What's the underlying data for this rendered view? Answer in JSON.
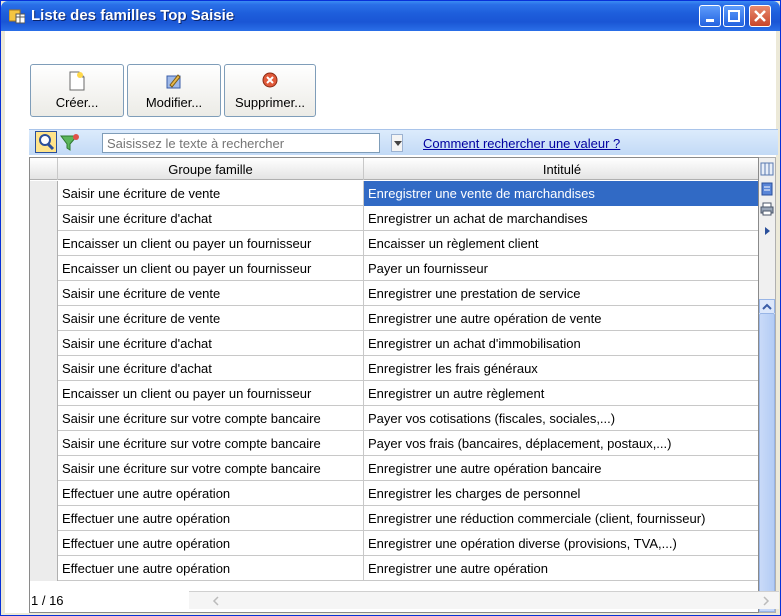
{
  "window": {
    "title": "Liste des familles Top Saisie",
    "icon": "folder-grid-icon"
  },
  "toolbar": {
    "create_label": "Créer...",
    "modify_label": "Modifier...",
    "delete_label": "Supprimer..."
  },
  "search": {
    "placeholder": "Saisissez le texte à rechercher",
    "help_link": "Comment rechercher une valeur ?"
  },
  "table": {
    "columns": [
      "Groupe famille",
      "Intitulé"
    ],
    "rows": [
      [
        "Saisir une écriture de vente",
        "Enregistrer une vente de marchandises"
      ],
      [
        "Saisir une écriture d'achat",
        "Enregistrer un achat de marchandises"
      ],
      [
        "Encaisser un client ou payer un fournisseur",
        "Encaisser un règlement client"
      ],
      [
        "Encaisser un client ou payer un fournisseur",
        "Payer un fournisseur"
      ],
      [
        "Saisir une écriture de vente",
        "Enregistrer une prestation de service"
      ],
      [
        "Saisir une écriture de vente",
        "Enregistrer une autre opération de vente"
      ],
      [
        "Saisir une écriture d'achat",
        "Enregistrer un achat d'immobilisation"
      ],
      [
        "Saisir une écriture d'achat",
        "Enregistrer les frais généraux"
      ],
      [
        "Encaisser un client ou payer un fournisseur",
        "Enregistrer un autre règlement"
      ],
      [
        "Saisir une écriture sur votre compte bancaire",
        "Payer vos cotisations (fiscales, sociales,...)"
      ],
      [
        "Saisir une écriture sur votre compte bancaire",
        "Payer vos frais (bancaires, déplacement, postaux,...)"
      ],
      [
        "Saisir une écriture sur votre compte bancaire",
        "Enregistrer une autre opération bancaire"
      ],
      [
        "Effectuer une autre opération",
        "Enregistrer les charges de personnel"
      ],
      [
        "Effectuer une autre opération",
        "Enregistrer une réduction commerciale (client, fournisseur)"
      ],
      [
        "Effectuer une autre opération",
        "Enregistrer une opération diverse (provisions, TVA,...)"
      ],
      [
        "Effectuer une autre opération",
        "Enregistrer une autre opération"
      ]
    ],
    "selected_row": 0
  },
  "status": {
    "count": "1 / 16"
  },
  "colors": {
    "titlebar": "#1E5FDC",
    "selection": "#316AC5",
    "link": "#0000A0"
  }
}
